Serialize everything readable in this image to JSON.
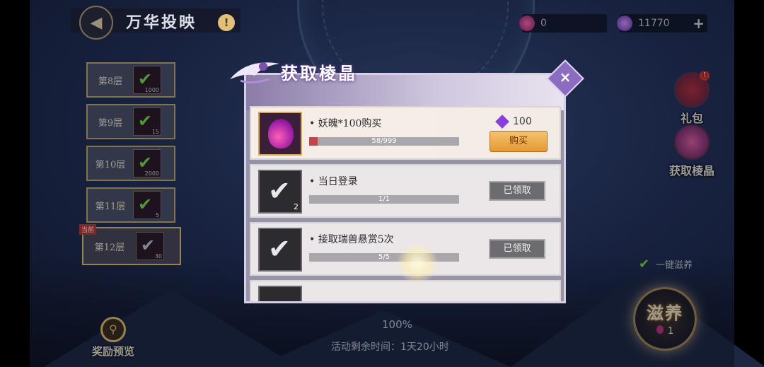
{
  "header": {
    "title": "万华投映",
    "info": "!"
  },
  "currencies": [
    {
      "icon": "demon-soul-icon",
      "value": "0"
    },
    {
      "icon": "prism-crystal-icon",
      "value": "11770",
      "plus": "+"
    }
  ],
  "floors": [
    {
      "label": "第8层",
      "count": "1000",
      "completed": true
    },
    {
      "label": "第9层",
      "count": "15",
      "completed": true
    },
    {
      "label": "第10层",
      "count": "2000",
      "completed": true
    },
    {
      "label": "第11层",
      "count": "5",
      "completed": true
    },
    {
      "label": "第12层",
      "count": "30",
      "completed": true,
      "tag": "当前"
    }
  ],
  "side": {
    "gift_label": "礼包",
    "gift_badge": "!",
    "get_crystal_label": "获取棱晶",
    "one_key_label": "一键滋养",
    "nurture_label": "滋养",
    "nurture_count": "1"
  },
  "bottom": {
    "reward_preview_label": "奖励预览",
    "progress_percent": "100%",
    "remaining_time": "活动剩余时间：1天20小时"
  },
  "modal": {
    "title": "获取棱晶",
    "close": "×",
    "tasks": [
      {
        "name": "• 妖魄*100购买",
        "progress_text": "58/999",
        "progress": 0.058,
        "price": "100",
        "button": "购买",
        "state": "buy"
      },
      {
        "name": "• 当日登录",
        "progress_text": "1/1",
        "progress": 1,
        "button": "已领取",
        "badge": "2",
        "state": "claimed"
      },
      {
        "name": "• 接取瑞兽悬赏5次",
        "progress_text": "5/5",
        "progress": 1,
        "button": "已领取",
        "state": "claimed"
      }
    ]
  },
  "colors": {
    "accent_gold": "#c6ab6e",
    "buy_button": "#e29a35",
    "progress_red": "#c2454c",
    "check_green": "#7de04a"
  }
}
